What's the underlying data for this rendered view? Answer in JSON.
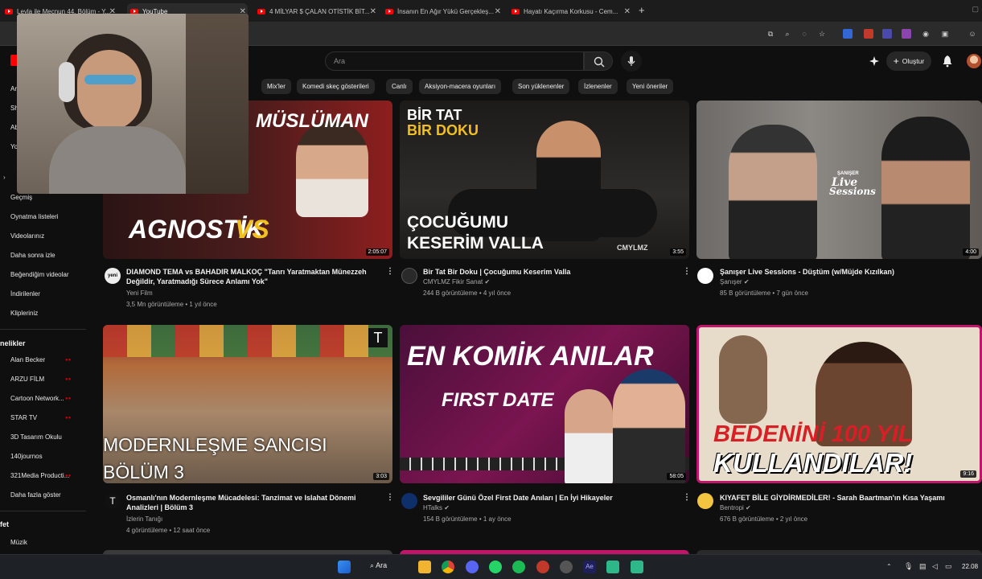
{
  "browser": {
    "tabs": [
      {
        "label": "Leyla ile Mecnun 44. Bölüm - Y..."
      },
      {
        "label": "YouTube"
      },
      {
        "label": "4 MİLYAR $ ÇALAN OTİSTİK BİT..."
      },
      {
        "label": "İnsanın En Ağır Yükü Gerçekleş..."
      },
      {
        "label": "Hayatı Kaçırma Korkusu - Cem..."
      }
    ],
    "new_tab": "+"
  },
  "header": {
    "search_placeholder": "Ara",
    "create_label": "Oluştur"
  },
  "chips": [
    "Mix'ler",
    "Komedi skeç gösterileri",
    "Canlı",
    "Aksiyon-macera oyunları",
    "Son yüklenenler",
    "İzlenenler",
    "Yeni öneriler"
  ],
  "sidebar": {
    "top_partial": [
      "Ar",
      "Sh",
      "Ab",
      "Yo"
    ],
    "items": [
      "Geçmiş",
      "Oynatma listeleri",
      "Videolarınız",
      "Daha sonra izle",
      "Beğendiğim videolar",
      "İndirilenler",
      "Klipleriniz"
    ],
    "subs_header": "nelikler",
    "subs": [
      "Alan Becker",
      "ARZU FİLM",
      "Cartoon Network...",
      "STAR TV",
      "3D Tasarım Okulu",
      "140journos",
      "321Media Producti..."
    ],
    "show_more": "Daha fazla göster",
    "explore_header": "fet",
    "explore_items": [
      "Müzik"
    ]
  },
  "videos": [
    {
      "title": "DIAMOND TEMA vs BAHADIR MALKOÇ \"Tanrı Yaratmaktan Münezzeh Değildir, Yaratmadığı Sürece Anlamı Yok\"",
      "channel": "Yeni Film",
      "views": "3,5 Mn görüntüleme",
      "age": "1 yıl önce",
      "duration": "2:05:07",
      "thumb_text": [
        "AGNOSTİK",
        "VS",
        "MÜSLÜMAN"
      ],
      "avatar_text": "yeni"
    },
    {
      "title": "Bir Tat Bir Doku | Çocuğumu Keserim Valla",
      "channel": "CMYLMZ Fikir Sanat",
      "views": "244 B görüntüleme",
      "age": "4 yıl önce",
      "duration": "3:55",
      "thumb_text": [
        "BİR TAT",
        "BİR DOKU",
        "ÇOCUĞUMU",
        "KESERİM VALLA",
        "CMYLMZ"
      ]
    },
    {
      "title": "Şanışer Live Sessions - Düştüm (w/Müjde Kızılkan)",
      "channel": "Şanışer",
      "views": "85 B görüntüleme",
      "age": "7 gün önce",
      "duration": "4:00",
      "thumb_text": [
        "ŞANIŞER",
        "Live",
        "Sessions"
      ]
    },
    {
      "title": "Osmanlı'nın Modernleşme Mücadelesi: Tanzimat ve Islahat Dönemi Analizleri | Bölüm 3",
      "channel": "İzlerin Tanığı",
      "views": "4 görüntüleme",
      "age": "12 saat önce",
      "duration": "3:03",
      "thumb_text": [
        "MODERNLEŞME SANCISI",
        "BÖLÜM 3"
      ]
    },
    {
      "title": "Sevgililer Günü Özel First Date Anıları | En İyi Hikayeler",
      "channel": "HTalks",
      "views": "154 B görüntüleme",
      "age": "1 ay önce",
      "duration": "58:05",
      "thumb_text": [
        "EN KOMİK ANILAR",
        "FIRST DATE"
      ]
    },
    {
      "title": "KIYAFET BİLE GİYDİRMEDİLER! - Sarah Baartman'ın Kısa Yaşamı",
      "channel": "Bentropi",
      "views": "676 B görüntüleme",
      "age": "2 yıl önce",
      "duration": "9:16",
      "thumb_text": [
        "BEDENİNİ 100 YIL",
        "KULLANDILAR!"
      ]
    }
  ],
  "taskbar": {
    "search_label": "Ara",
    "clock": "22.08"
  },
  "colors": {
    "yt_red": "#ff0000",
    "bg": "#0f0f0f",
    "chip_bg": "#272727"
  }
}
